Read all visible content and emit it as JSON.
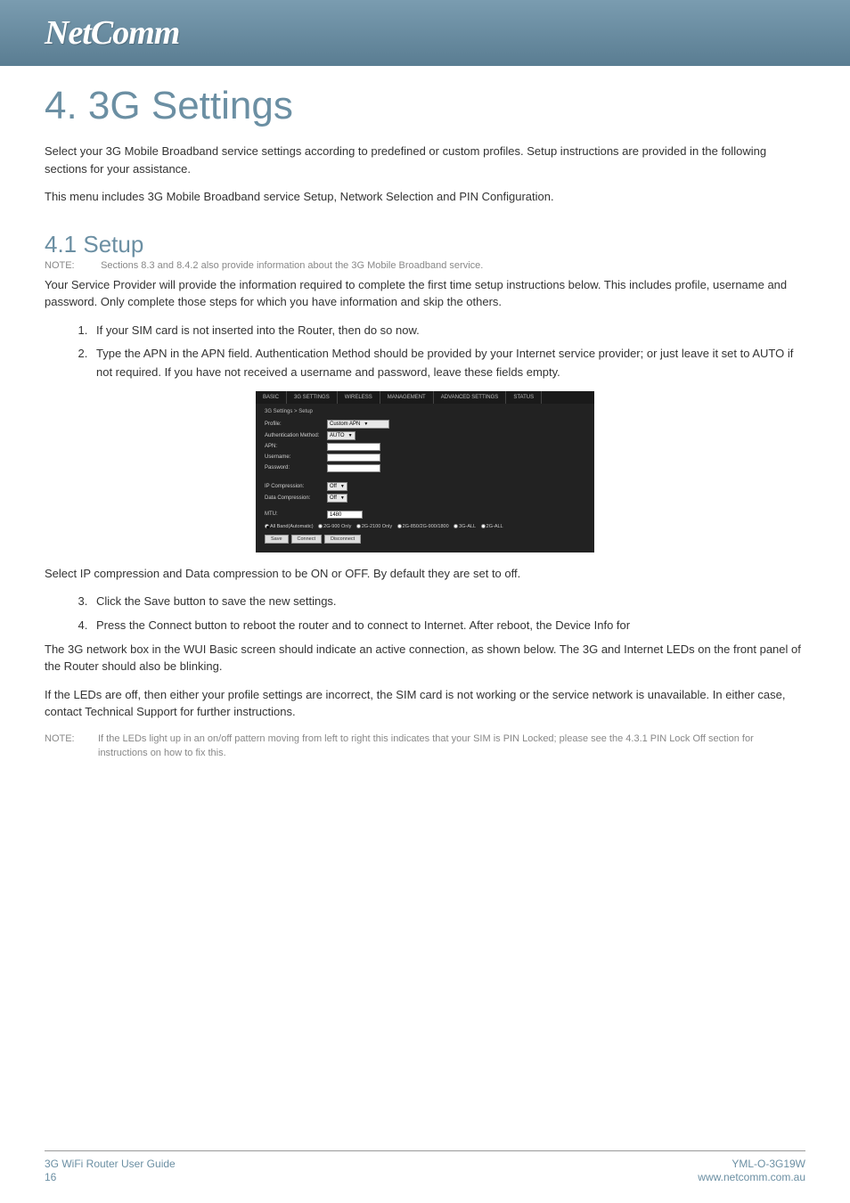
{
  "header": {
    "logo": "NetComm"
  },
  "title": "4. 3G Settings",
  "intro1": "Select your 3G Mobile Broadband service settings according to predefined or custom profiles. Setup instructions are provided in the following sections for your assistance.",
  "intro2": "This menu includes 3G Mobile Broadband service Setup, Network Selection and PIN Configuration.",
  "section": {
    "heading": "4.1 Setup",
    "note1_label": "NOTE:",
    "note1_text": "Sections 8.3 and 8.4.2 also provide information about the 3G Mobile Broadband service.",
    "para1": "Your Service Provider will provide the information required to complete the first time setup instructions below. This includes profile, username and password. Only complete those steps for which you have information and skip the others.",
    "steps_a": [
      "If your SIM card is not inserted into the Router, then do so now.",
      "Type the APN in the APN field. Authentication Method should be provided by your Internet service provider; or just leave it set to AUTO if not required. If you have not received a username and password, leave these fields empty."
    ],
    "para2": "Select IP compression and Data compression to be ON or OFF. By default they are set to off.",
    "steps_b": [
      "Click the Save button to save the new settings.",
      "Press the Connect button to reboot the router and to connect to Internet. After reboot, the Device Info for"
    ],
    "para3": "The 3G network box in the WUI Basic screen should indicate an active connection, as shown below. The 3G and Internet LEDs on the front panel of the Router should also be blinking.",
    "para4": "If the LEDs are off, then either your profile settings are incorrect, the SIM card is not working or the service network is unavailable. In either case, contact Technical Support for further instructions.",
    "note2_label": "NOTE:",
    "note2_text": "If the LEDs light up in an on/off pattern moving from left to right this indicates that your SIM is PIN Locked; please see the 4.3.1 PIN Lock Off section for instructions on how to fix this."
  },
  "screenshot": {
    "tabs": [
      "BASIC",
      "3G SETTINGS",
      "WIRELESS",
      "MANAGEMENT",
      "ADVANCED SETTINGS",
      "STATUS"
    ],
    "breadcrumb": "3G Settings > Setup",
    "fields": {
      "profile_label": "Profile:",
      "profile_value": "Custom APN",
      "auth_label": "Authentication Method:",
      "auth_value": "AUTO",
      "apn_label": "APN:",
      "apn_value": "",
      "user_label": "Username:",
      "user_value": "",
      "pass_label": "Password:",
      "pass_value": "",
      "ipcomp_label": "IP Compression:",
      "ipcomp_value": "Off",
      "datacomp_label": "Data Compression:",
      "datacomp_value": "Off",
      "mtu_label": "MTU:",
      "mtu_value": "1480"
    },
    "radios": [
      "All Band(Automatic)",
      "2G-900 Only",
      "2G-2100 Only",
      "2G-850/2G-900/1800",
      "3G-ALL",
      "2G-ALL"
    ],
    "buttons": [
      "Save",
      "Connect",
      "Disconnect"
    ]
  },
  "footer": {
    "left_title": "3G WiFi Router User Guide",
    "left_page": "16",
    "right_model": "YML-O-3G19W",
    "right_url": "www.netcomm.com.au"
  }
}
